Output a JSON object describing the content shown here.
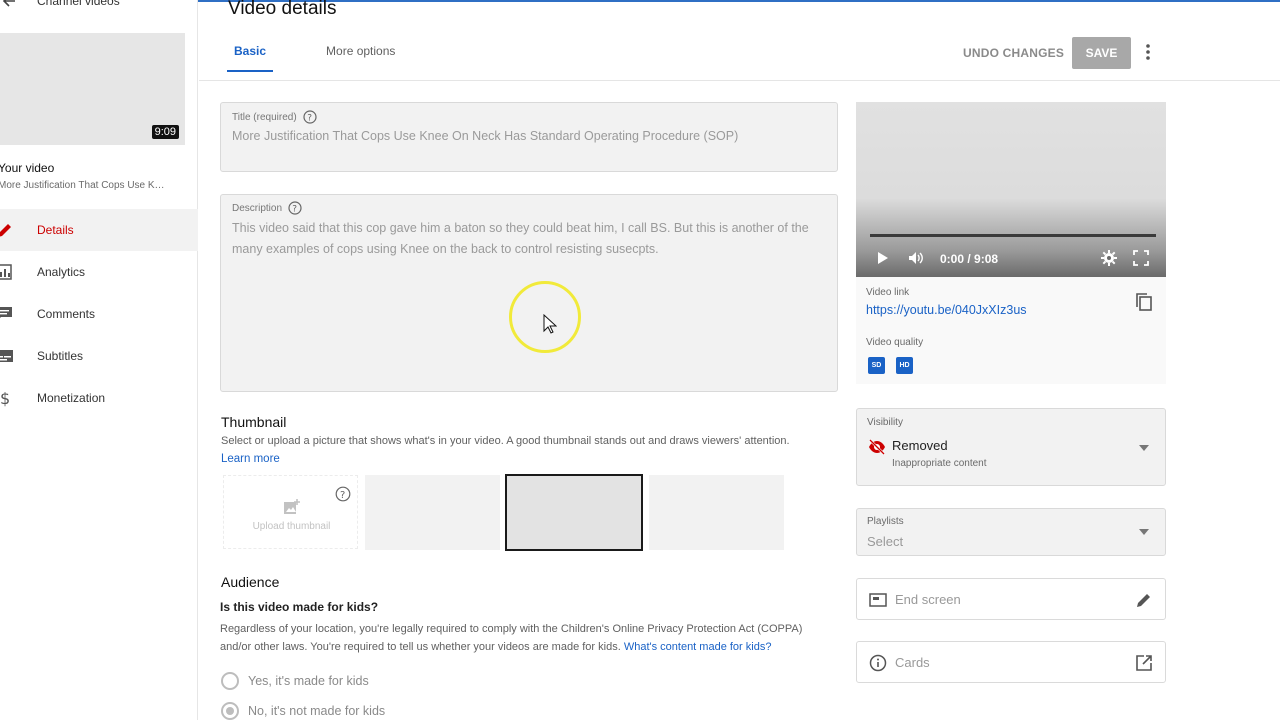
{
  "sidebar": {
    "back_label": "Channel videos",
    "duration": "9:09",
    "your_video_label": "Your video",
    "video_title": "More Justification That Cops Use K…",
    "items": [
      {
        "label": "Details",
        "icon": "pencil-icon"
      },
      {
        "label": "Analytics",
        "icon": "bar-chart-icon"
      },
      {
        "label": "Comments",
        "icon": "comment-icon"
      },
      {
        "label": "Subtitles",
        "icon": "subtitles-icon"
      },
      {
        "label": "Monetization",
        "icon": "dollar-icon"
      }
    ]
  },
  "header": {
    "title": "Video details",
    "tabs": [
      {
        "label": "Basic"
      },
      {
        "label": "More options"
      }
    ],
    "undo_label": "UNDO CHANGES",
    "save_label": "SAVE"
  },
  "form": {
    "title_label": "Title (required)",
    "title_value": "More Justification That Cops Use Knee On Neck Has Standard Operating Procedure (SOP)",
    "description_label": "Description",
    "description_value": "This video said that this cop gave him a baton so they could beat him, I call BS. But this is another of the many examples of cops using Knee on the back to control resisting susecpts."
  },
  "thumbnail": {
    "heading": "Thumbnail",
    "help_text": "Select or upload a picture that shows what's in your video. A good thumbnail stands out and draws viewers' attention.",
    "learn_more": "Learn more",
    "upload_label": "Upload thumbnail"
  },
  "audience": {
    "heading": "Audience",
    "question": "Is this video made for kids?",
    "text_1": "Regardless of your location, you're legally required to comply with the Children's Online Privacy Protection Act (COPPA)",
    "text_2": "and/or other laws. You're required to tell us whether your videos are made for kids.",
    "link": "What's content made for kids?",
    "options": [
      "Yes, it's made for kids",
      "No, it's not made for kids"
    ],
    "selected": "No, it's not made for kids"
  },
  "player": {
    "time": "0:00 / 9:08"
  },
  "video_info": {
    "link_label": "Video link",
    "link_url": "https://youtu.be/040JxXIz3us",
    "quality_label": "Video quality",
    "quality_badges": [
      "SD",
      "HD"
    ]
  },
  "visibility": {
    "label": "Visibility",
    "value": "Removed",
    "subtext": "Inappropriate content"
  },
  "playlists": {
    "label": "Playlists",
    "value": "Select"
  },
  "end_screen_label": "End screen",
  "cards_label": "Cards",
  "colors": {
    "accent": "#1a62c6",
    "active_nav": "#cc0000",
    "removed_icon": "#cc0000",
    "cursor_highlight": "#f1ea3a"
  }
}
